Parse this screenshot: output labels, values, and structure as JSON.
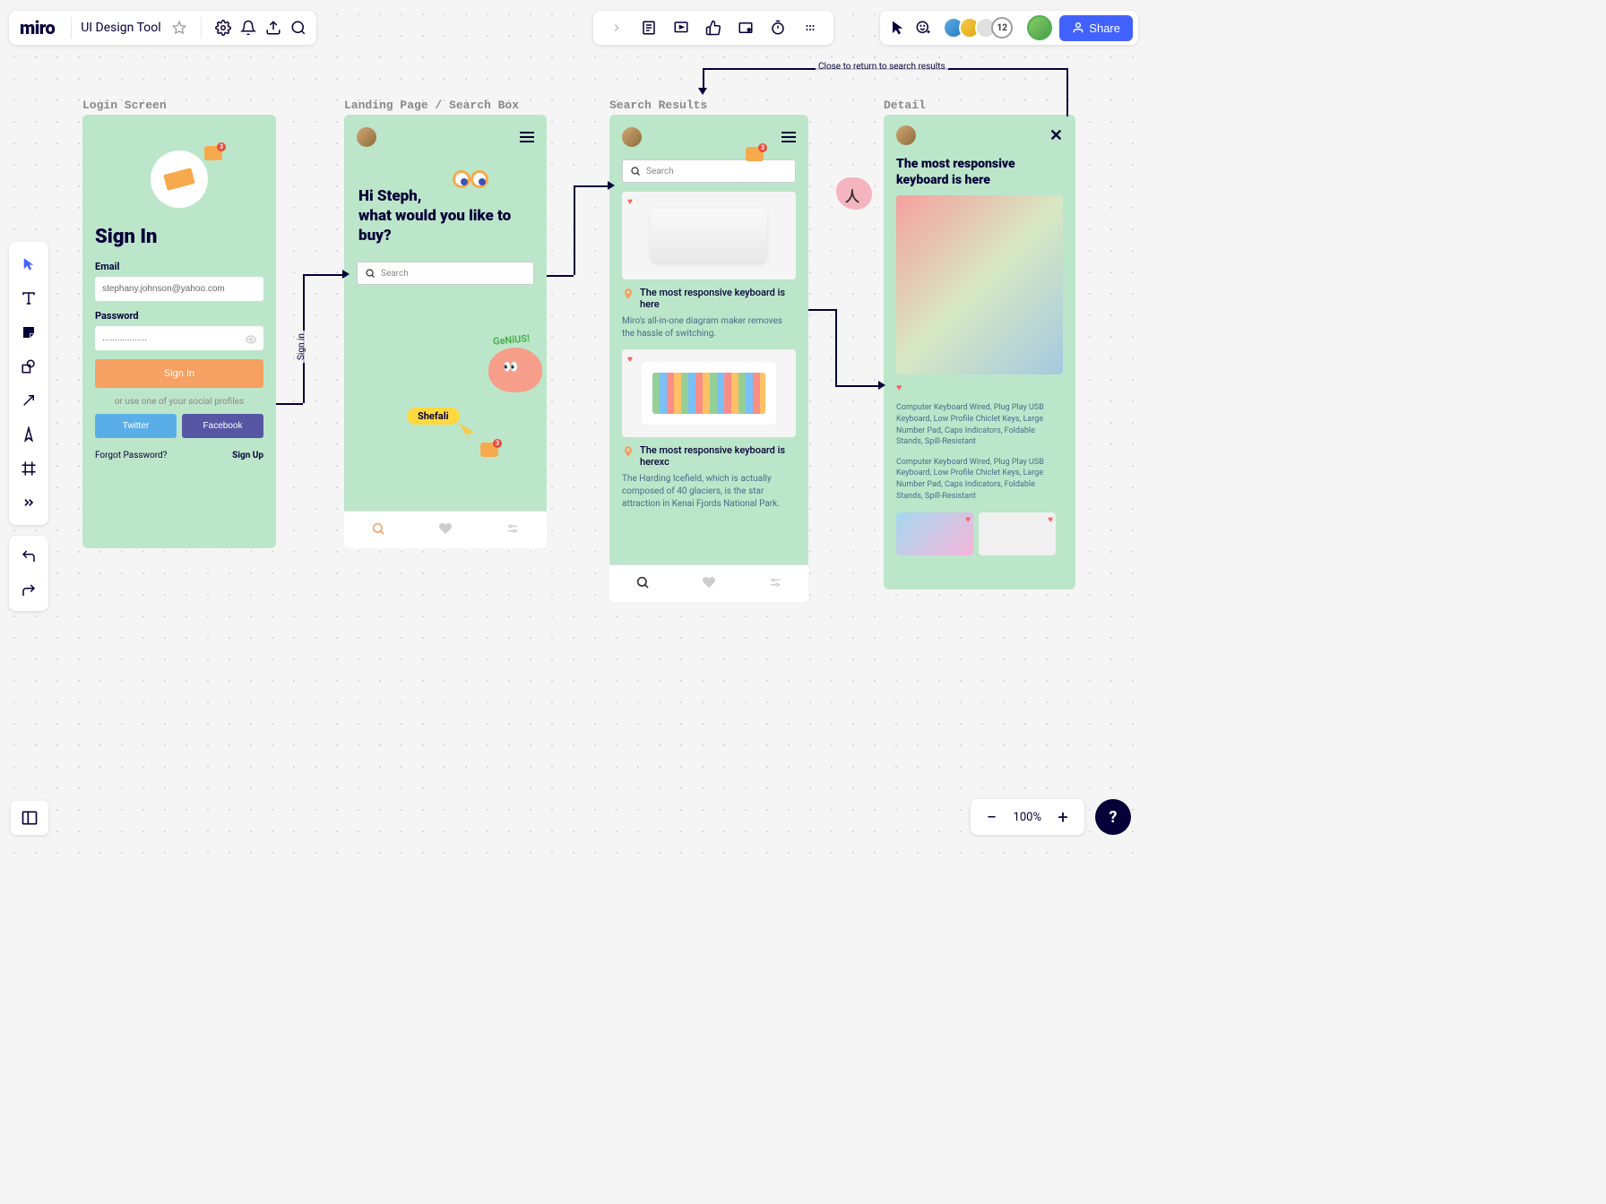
{
  "app": {
    "logo": "miro",
    "board_title": "UI Design Tool"
  },
  "share": {
    "label": "Share"
  },
  "avatar_count": "12",
  "zoom": {
    "value": "100%"
  },
  "frames": {
    "login": {
      "label": "Login Screen",
      "title": "Sign In",
      "email_label": "Email",
      "email_value": "stephany.johnson@yahoo.com",
      "password_label": "Password",
      "password_value": "..................",
      "signin_btn": "Sign In",
      "alt_text": "or use one of your social profiles",
      "twitter": "Twitter",
      "facebook": "Facebook",
      "forgot": "Forgot Password?",
      "signup": "Sign Up",
      "comment_badge": "3"
    },
    "landing": {
      "label": "Landing Page / Search Box",
      "greeting": "Hi Steph,\nwhat would you like to buy?",
      "search_placeholder": "Search",
      "genius_text": "GeNiUS!",
      "name_tag": "Shefali",
      "comment_badge": "3"
    },
    "results": {
      "label": "Search Results",
      "search_placeholder": "Search",
      "comment_badge": "3",
      "item1_title": "The most responsive keyboard is here",
      "item1_desc": "Miro's all-in-one diagram maker removes the hassle of switching.",
      "item2_title": "The most responsive keyboard is herexc",
      "item2_desc": "The Harding Icefield, which is actually composed of 40 glaciers, is the star attraction in Kenai Fjords National Park."
    },
    "detail": {
      "label": "Detail",
      "title": "The most responsive keyboard is here",
      "desc1": "Computer Keyboard Wired, Plug Play USB Keyboard, Low Profile Chiclet Keys, Large Number Pad, Caps Indicators, Foldable Stands, Spill-Resistant",
      "desc2": "Computer Keyboard Wired, Plug Play USB Keyboard, Low Profile Chiclet Keys, Large Number Pad, Caps Indicators, Foldable Stands, Spill-Resistant"
    }
  },
  "flows": {
    "signin": "Sign in",
    "close_return": "Close to return to search results"
  }
}
